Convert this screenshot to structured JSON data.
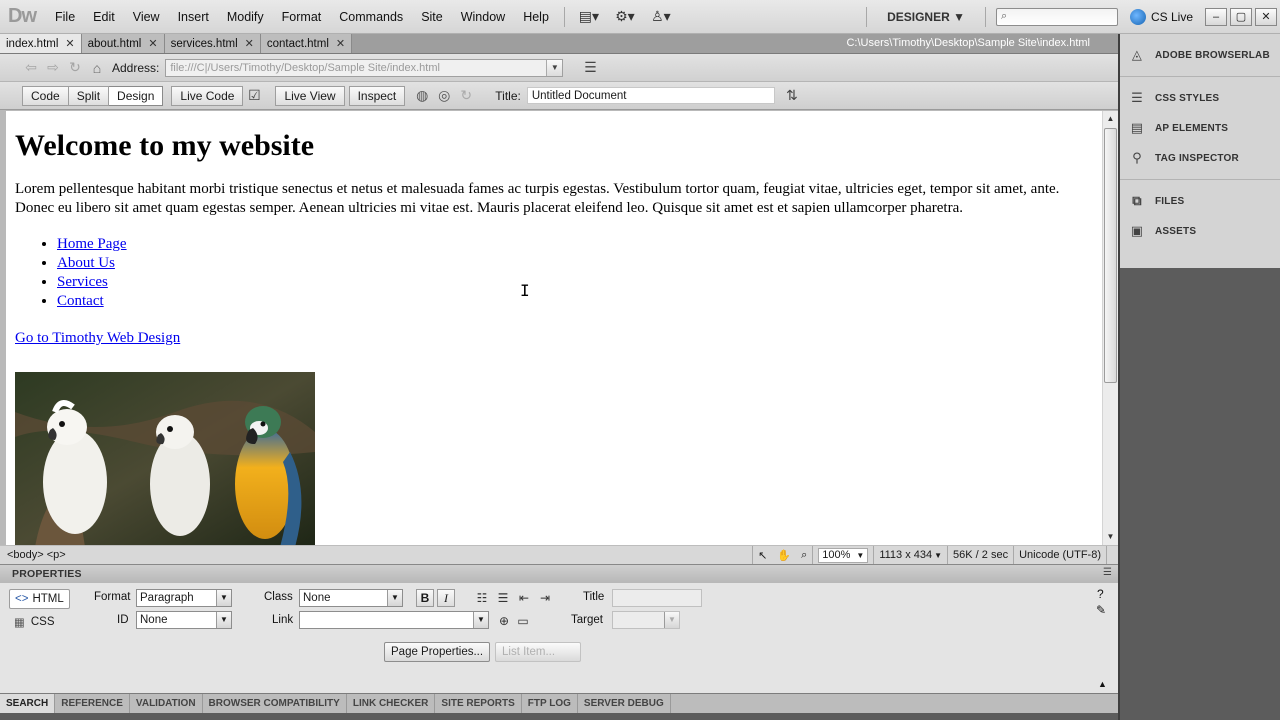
{
  "app": {
    "logo": "Dw",
    "menu": [
      "File",
      "Edit",
      "View",
      "Insert",
      "Modify",
      "Format",
      "Commands",
      "Site",
      "Window",
      "Help"
    ],
    "workspace": "DESIGNER ▼",
    "cs_live": "CS Live"
  },
  "tabs": [
    "index.html",
    "about.html",
    "services.html",
    "contact.html"
  ],
  "doc_path": "C:\\Users\\Timothy\\Desktop\\Sample Site\\index.html",
  "address": {
    "label": "Address:",
    "value": "file:///C|/Users/Timothy/Desktop/Sample Site/index.html"
  },
  "view_toolbar": {
    "code": "Code",
    "split": "Split",
    "design": "Design",
    "live_code": "Live Code",
    "live_view": "Live View",
    "inspect": "Inspect",
    "title_label": "Title:",
    "title_value": "Untitled Document"
  },
  "page": {
    "heading": "Welcome to my website",
    "paragraph": "Lorem pellentesque habitant morbi tristique senectus et netus et malesuada fames ac turpis egestas. Vestibulum tortor quam, feugiat vitae, ultricies eget, tempor sit amet, ante. Donec eu libero sit amet quam egestas semper. Aenean ultricies mi vitae est. Mauris placerat eleifend leo. Quisque sit amet est et sapien ullamcorper pharetra.",
    "nav_links": [
      "Home Page",
      "About Us",
      "Services",
      "Contact"
    ],
    "external_link": "Go to Timothy Web Design"
  },
  "status": {
    "tag_selector": "<body> <p>",
    "zoom": "100%",
    "window_size": "1113 x 434",
    "download": "56K / 2 sec",
    "encoding": "Unicode (UTF-8)"
  },
  "properties": {
    "header": "PROPERTIES",
    "html_mode": "HTML",
    "css_mode": "CSS",
    "format_label": "Format",
    "format_value": "Paragraph",
    "id_label": "ID",
    "id_value": "None",
    "class_label": "Class",
    "class_value": "None",
    "link_label": "Link",
    "link_value": "",
    "title_label": "Title",
    "target_label": "Target",
    "page_properties": "Page Properties...",
    "list_item": "List Item..."
  },
  "results_tabs": [
    "SEARCH",
    "REFERENCE",
    "VALIDATION",
    "BROWSER COMPATIBILITY",
    "LINK CHECKER",
    "SITE REPORTS",
    "FTP LOG",
    "SERVER DEBUG"
  ],
  "right_panels": {
    "group1": [
      "ADOBE BROWSERLAB"
    ],
    "group2": [
      "CSS STYLES",
      "AP ELEMENTS",
      "TAG INSPECTOR"
    ],
    "group3": [
      "FILES",
      "ASSETS"
    ]
  }
}
